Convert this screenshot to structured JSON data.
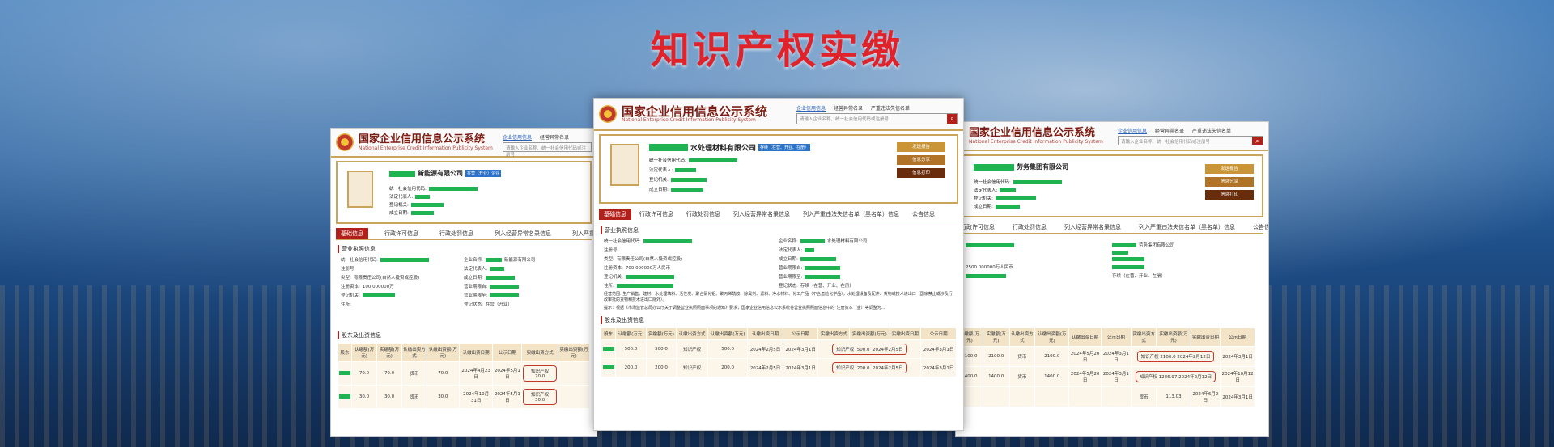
{
  "banner_title": "知识产权实缴",
  "site": {
    "name_cn": "国家企业信用信息公示系统",
    "name_en": "National Enterprise Credit Information Publicity System",
    "nav": [
      "企业信用信息",
      "经营异常名录",
      "严重违法失信名单"
    ],
    "search_placeholder": "请输入企业名称、统一社会信用代码或注册号",
    "search_icon": "magnifier-icon"
  },
  "center": {
    "company": "水处理材料有限公司",
    "status_tag": "存续（在营、开业、在册）",
    "fields": [
      "统一社会信用代码:",
      "法定代表人:",
      "登记机关:",
      "成立日期:"
    ],
    "buttons": [
      "发送报告",
      "信息分享",
      "信息打印"
    ],
    "tabs": [
      "基础信息",
      "行政许可信息",
      "行政处罚信息",
      "列入经营异常名录信息",
      "列入严重违法失信名单（黑名单）信息",
      "公告信息"
    ],
    "section1": "营业执照信息",
    "info_left": [
      "统一社会信用代码:",
      "注册号:",
      "类型:",
      "注册资本:",
      "登记机关:",
      "住所:"
    ],
    "info_left_vals": [
      "",
      "",
      "有限责任公司(自然人投资或控股)",
      "700.000000万人民币",
      "",
      ""
    ],
    "info_right": [
      "企业名称:",
      "法定代表人:",
      "成立日期:",
      "营业期限自:",
      "营业期限至:",
      "登记状态:"
    ],
    "info_right_vals": [
      "水处理材料有限公司",
      "",
      "",
      "",
      "",
      "存续（在营、开业、在册）"
    ],
    "scope": "经营范围: 生产销售、建材、水处理填料、活性炭、聚合氯化铝、聚丙烯酰胺、除臭剂、滤料、净水材料、化工产品（不含危险化学品），水处理设备及配件、货物或技术进出口（国家禁止或涉及行政审批的货物和技术进出口除外）。",
    "notice": "提示：根据《市场监管总局办公厅关于调整营业执照照面事项的通知》要求，国家企业信用信息公示系统将营业执照照面信息中的“注册资本（金）”等调整为...",
    "section2": "股东及出资信息",
    "table_head": [
      "股东",
      "认缴额(万元)",
      "实缴额(万元)",
      "认缴出资方式",
      "认缴出资额(万元)",
      "认缴出资日期",
      "公示日期",
      "实缴出资方式",
      "实缴出资额(万元)",
      "实缴出资日期",
      "公示日期"
    ],
    "rows": [
      [
        "",
        "500.0",
        "500.0",
        "知识产权",
        "500.0",
        "2024年2月5日",
        "2024年3月1日",
        "知识产权",
        "500.0",
        "2024年2月5日",
        "2024年3月1日"
      ],
      [
        "",
        "200.0",
        "200.0",
        "知识产权",
        "200.0",
        "2024年2月5日",
        "2024年3月1日",
        "知识产权",
        "200.0",
        "2024年2月5日",
        "2024年3月1日"
      ]
    ]
  },
  "left": {
    "company": "新能源有限公司",
    "status_tag": "在营（开业）企业",
    "fields": [
      "统一社会信用代码:",
      "法定代表人:",
      "登记机关:",
      "成立日期:"
    ],
    "tabs": [
      "基础信息",
      "行政许可信息",
      "行政处罚信息",
      "列入经营异常名录信息",
      "列入严重违法失信名单（黑名单）信息"
    ],
    "section1": "营业执照信息",
    "info_left": [
      "统一社会信用代码:",
      "注册号:",
      "类型:",
      "注册资本:",
      "登记机关:",
      "住所:"
    ],
    "info_left_vals": [
      "",
      "",
      "有限责任公司(自然人投资或控股)",
      "100.000000万",
      "",
      ""
    ],
    "info_right": [
      "企业名称:",
      "法定代表人:",
      "成立日期:",
      "营业期限自:",
      "营业期限至:",
      "登记状态:"
    ],
    "info_right_vals": [
      "新能源有限公司",
      "",
      "",
      "",
      "",
      "在营（开业）"
    ],
    "section2": "股东及出资信息",
    "table_head": [
      "股东",
      "认缴额(万元)",
      "实缴额(万元)",
      "认缴出资方式",
      "认缴出资额(万元)",
      "认缴出资日期",
      "公示日期",
      "实缴出资方式",
      "实缴出资额(万元)"
    ],
    "rows": [
      [
        "",
        "70.0",
        "70.0",
        "货币",
        "70.0",
        "2024年4月23日",
        "2024年5月1日",
        "知识产权",
        "70.0"
      ],
      [
        "",
        "30.0",
        "30.0",
        "货币",
        "30.0",
        "2024年10月31日",
        "2024年5月1日",
        "知识产权",
        "30.0"
      ]
    ]
  },
  "right": {
    "company": "劳务集团有限公司",
    "status_tag": "存续（在营、开业、在册）",
    "fields": [
      "统一社会信用代码:",
      "法定代表人:",
      "登记机关:",
      "成立日期:"
    ],
    "buttons": [
      "发送报告",
      "信息分享",
      "信息打印"
    ],
    "tabs": [
      "行政许可信息",
      "行政处罚信息",
      "列入经营异常名录信息",
      "列入严重违法失信名单（黑名单）信息",
      "公告信息"
    ],
    "info_left_vals": [
      "",
      "",
      "",
      "2500.000000万人民币",
      "",
      ""
    ],
    "info_right_vals": [
      "劳务集团有限公司",
      "",
      "",
      "",
      "",
      "存续（在营、开业、在册）"
    ],
    "table_head": [
      "认缴额(万元)",
      "实缴额(万元)",
      "认缴出资方式",
      "认缴出资额(万元)",
      "认缴出资日期",
      "公示日期",
      "实缴出资方式",
      "实缴出资额(万元)",
      "实缴出资日期",
      "公示日期"
    ],
    "rows": [
      [
        "2100.0",
        "2100.0",
        "货币",
        "2100.0",
        "2024年5月20日",
        "2024年3月1日",
        "知识产权",
        "2100.0",
        "2024年2月12日",
        "2024年3月1日"
      ],
      [
        "1400.0",
        "1400.0",
        "货币",
        "1400.0",
        "2024年5月20日",
        "2024年3月1日",
        "知识产权",
        "1286.97",
        "2024年2月12日",
        "2024年10月12日"
      ],
      [
        "",
        "",
        "",
        "",
        "",
        "",
        "货币",
        "113.03",
        "2024年6月2日",
        "2024年3月1日"
      ]
    ]
  }
}
